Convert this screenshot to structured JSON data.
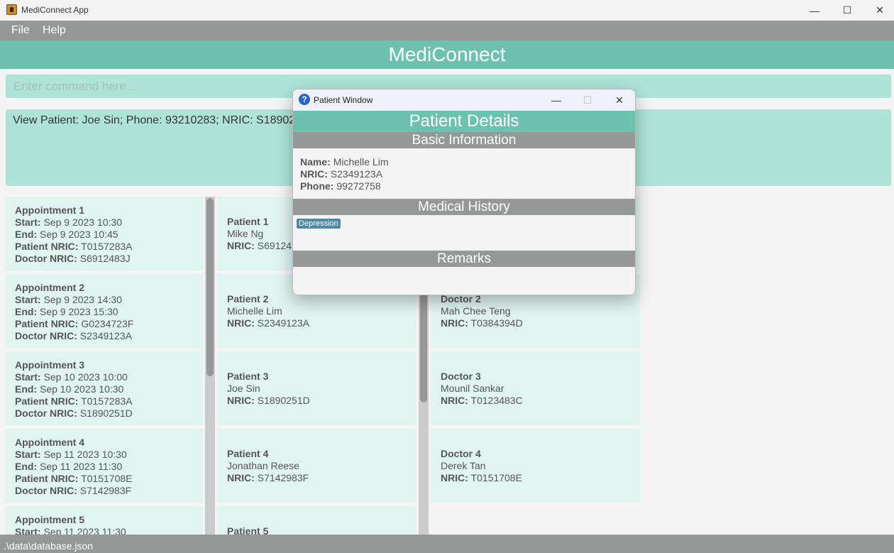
{
  "window": {
    "title": "MediConnect App",
    "minimize": "—",
    "maximize": "☐",
    "close": "✕"
  },
  "menu": [
    "File",
    "Help"
  ],
  "header": {
    "title": "MediConnect"
  },
  "command": {
    "placeholder": "Enter command here...",
    "value": ""
  },
  "result": "View Patient: Joe Sin; Phone: 93210283; NRIC: S18902",
  "appointments": [
    {
      "title": "Appointment 1",
      "start": "Sep 9 2023 10:30",
      "end": "Sep 9 2023 10:45",
      "patient_nric": "T0157283A",
      "doctor_nric": "S6912483J"
    },
    {
      "title": "Appointment 2",
      "start": "Sep 9 2023 14:30",
      "end": "Sep 9 2023 15:30",
      "patient_nric": "G0234723F",
      "doctor_nric": "S2349123A"
    },
    {
      "title": "Appointment 3",
      "start": "Sep 10 2023 10:00",
      "end": "Sep 10 2023 10:30",
      "patient_nric": "T0157283A",
      "doctor_nric": "S1890251D"
    },
    {
      "title": "Appointment 4",
      "start": "Sep 11 2023 10:30",
      "end": "Sep 11 2023 11:30",
      "patient_nric": "T0151708E",
      "doctor_nric": "S7142983F"
    },
    {
      "title": "Appointment 5",
      "start": "Sep 11 2023 11:30"
    }
  ],
  "labels": {
    "start": "Start:",
    "end": "End:",
    "patient_nric": "Patient NRIC:",
    "doctor_nric": "Doctor NRIC:",
    "nric": "NRIC:",
    "name": "Name:",
    "phone": "Phone:"
  },
  "patients": [
    {
      "title": "Patient 1",
      "name": "Mike Ng",
      "nric": "S69124"
    },
    {
      "title": "Patient 2",
      "name": "Michelle Lim",
      "nric": "S2349123A"
    },
    {
      "title": "Patient 3",
      "name": "Joe Sin",
      "nric": "S1890251D"
    },
    {
      "title": "Patient 4",
      "name": "Jonathan Reese",
      "nric": "S7142983F"
    },
    {
      "title": "Patient 5"
    }
  ],
  "doctors": [
    {
      "title": "Doctor 2",
      "name": "Mah Chee Teng",
      "nric": "T0384394D"
    },
    {
      "title": "Doctor 3",
      "name": "Mounil Sankar",
      "nric": "T0123483C"
    },
    {
      "title": "Doctor 4",
      "name": "Derek Tan",
      "nric": "T0151708E"
    }
  ],
  "status": ".\\data\\database.json",
  "popup": {
    "title": "Patient Window",
    "heading": "Patient Details",
    "basic": "Basic Information",
    "name": "Michelle Lim",
    "nric": "S2349123A",
    "phone": "99272758",
    "medical": "Medical History",
    "tags": [
      "Depression"
    ],
    "remarks": "Remarks"
  },
  "colors": {
    "accent": "#6cc2ae",
    "bar": "#959897",
    "card": "#e0f4f0",
    "input": "#aee4d8",
    "tag": "#4b8aa1"
  }
}
